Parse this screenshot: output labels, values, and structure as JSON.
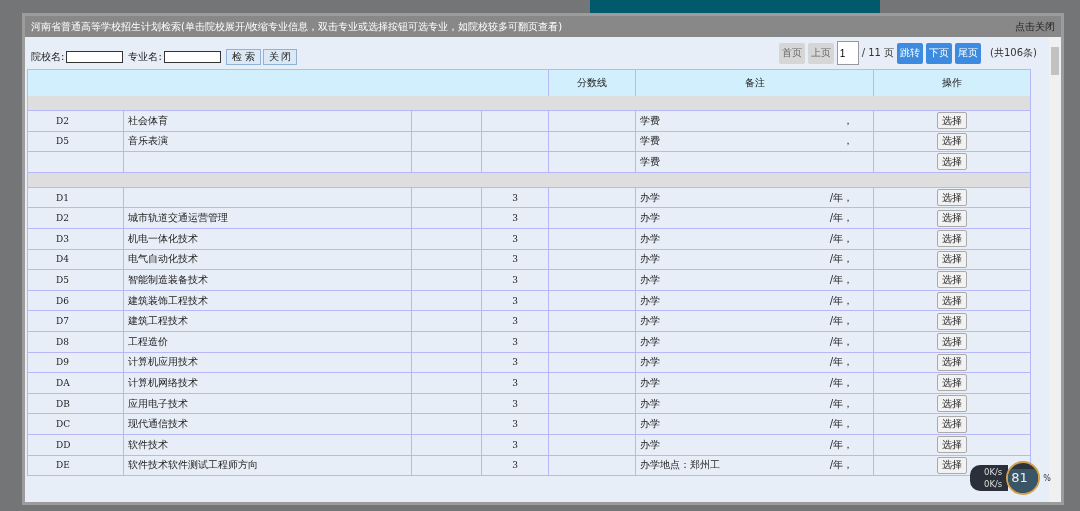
{
  "window": {
    "title": "河南省普通高等学校招生计划检索(单击院校展开/收缩专业信息，双击专业或选择按钮可选专业，如院校较多可翻页查看)",
    "close_link": "点击关闭"
  },
  "search": {
    "fields": [
      {
        "label": "院校名:"
      },
      {
        "label": "专业名:"
      }
    ],
    "buttons": [
      "检 索",
      "关 闭"
    ]
  },
  "pager": {
    "nav_before": [
      {
        "label": "首页",
        "disabled": true
      },
      {
        "label": "上页",
        "disabled": true
      }
    ],
    "page_value": "1",
    "page_total": "/ 11 页",
    "nav_after": [
      {
        "label": "跳转",
        "disabled": false
      },
      {
        "label": "下页",
        "disabled": false
      },
      {
        "label": "尾页",
        "disabled": false
      }
    ],
    "count": "(共106条)"
  },
  "table": {
    "columns": [
      "分数线",
      "备注",
      "操作"
    ],
    "rows": [
      {
        "kind": "group"
      },
      {
        "kind": "item",
        "code": "D2",
        "name": "社会体育",
        "remark_start": "学费",
        "remark_end": "，",
        "action": "选择"
      },
      {
        "kind": "item",
        "code": "D5",
        "name": "音乐表演",
        "remark_start": "学费",
        "remark_end": "，",
        "action": "选择"
      },
      {
        "kind": "item",
        "remark_start": "学费",
        "action": "选择"
      },
      {
        "kind": "group"
      },
      {
        "kind": "item",
        "code": "D1",
        "count": "3",
        "remark_start": "办学",
        "remark_end": "/年，",
        "action": "选择"
      },
      {
        "kind": "item",
        "code": "D2",
        "name": "城市轨道交通运营管理",
        "count": "3",
        "remark_start": "办学",
        "remark_end": "/年，",
        "action": "选择"
      },
      {
        "kind": "item",
        "code": "D3",
        "name": "机电一体化技术",
        "count": "3",
        "remark_start": "办学",
        "remark_end": "/年，",
        "action": "选择"
      },
      {
        "kind": "item",
        "code": "D4",
        "name": "电气自动化技术",
        "count": "3",
        "remark_start": "办学",
        "remark_end": "/年，",
        "action": "选择"
      },
      {
        "kind": "item",
        "code": "D5",
        "name": "智能制造装备技术",
        "count": "3",
        "remark_start": "办学",
        "remark_end": "/年，",
        "action": "选择"
      },
      {
        "kind": "item",
        "code": "D6",
        "name": "建筑装饰工程技术",
        "count": "3",
        "remark_start": "办学",
        "remark_end": "/年，",
        "action": "选择"
      },
      {
        "kind": "item",
        "code": "D7",
        "name": "建筑工程技术",
        "count": "3",
        "remark_start": "办学",
        "remark_end": "/年，",
        "action": "选择"
      },
      {
        "kind": "item",
        "code": "D8",
        "name": "工程造价",
        "count": "3",
        "remark_start": "办学",
        "remark_end": "/年，",
        "action": "选择"
      },
      {
        "kind": "item",
        "code": "D9",
        "name": "计算机应用技术",
        "count": "3",
        "remark_start": "办学",
        "remark_end": "/年，",
        "action": "选择"
      },
      {
        "kind": "item",
        "code": "DA",
        "name": "计算机网络技术",
        "count": "3",
        "remark_start": "办学",
        "remark_end": "/年，",
        "action": "选择"
      },
      {
        "kind": "item",
        "code": "DB",
        "name": "应用电子技术",
        "count": "3",
        "remark_start": "办学",
        "remark_end": "/年，",
        "action": "选择"
      },
      {
        "kind": "item",
        "code": "DC",
        "name": "现代通信技术",
        "count": "3",
        "remark_start": "办学",
        "remark_end": "/年，",
        "action": "选择"
      },
      {
        "kind": "item",
        "code": "DD",
        "name": "软件技术",
        "count": "3",
        "remark_start": "办学",
        "remark_end": "/年，",
        "action": "选择"
      },
      {
        "kind": "item",
        "code": "DE",
        "name": "软件技术软件测试工程师方向",
        "count": "3",
        "remark_start": "办学地点：郑州工",
        "remark_end": "/年，",
        "action": "选择"
      }
    ]
  },
  "speed_widget": {
    "upload": "0K/s",
    "download": "0K/s",
    "percent": "81",
    "unit": "%",
    "level": 0.81
  }
}
